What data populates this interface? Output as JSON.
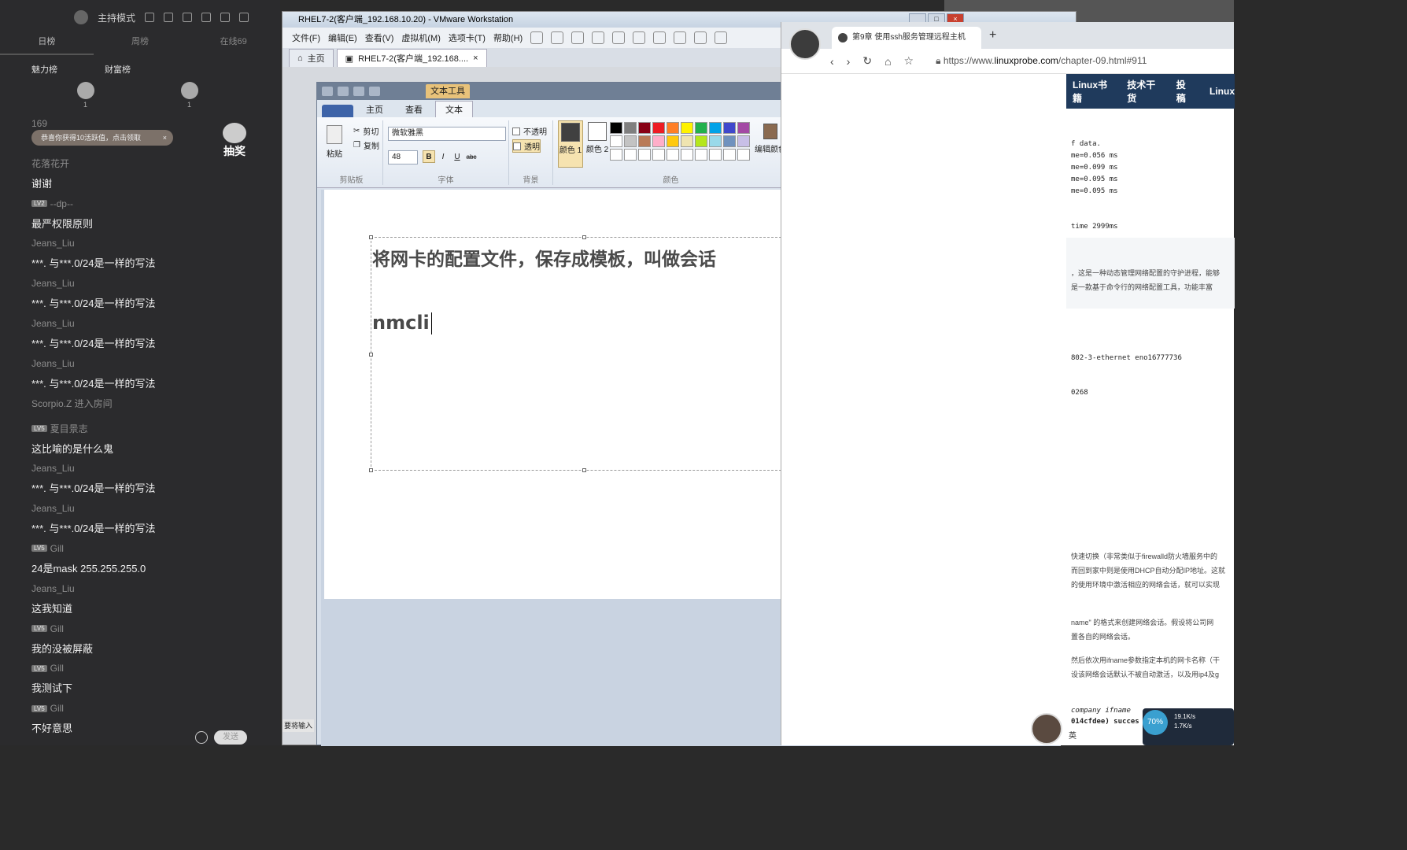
{
  "chat": {
    "mode_label": "主持模式",
    "tabs": [
      "日榜",
      "周榜",
      "在线69"
    ],
    "rank_charm": "魅力榜",
    "rank_wealth": "财富榜",
    "rank_counts": [
      "1",
      "1"
    ],
    "toast": "恭喜你获得10活跃值，点击领取",
    "toast_close": "×",
    "lottery": "抽奖",
    "send": "发送",
    "messages": [
      {
        "user": "169",
        "level": "",
        "text": ""
      },
      {
        "user": "花落花开",
        "level": "",
        "text": "谢谢"
      },
      {
        "user": "--dp--",
        "level": "LV2",
        "text": "最严权限原则"
      },
      {
        "user": "Jeans_Liu",
        "level": "",
        "text": "***. 与***.0/24是一样的写法"
      },
      {
        "user": "Jeans_Liu",
        "level": "",
        "text": "***. 与***.0/24是一样的写法"
      },
      {
        "user": "Jeans_Liu",
        "level": "",
        "text": "***. 与***.0/24是一样的写法"
      },
      {
        "user": "Jeans_Liu",
        "level": "",
        "text": "***. 与***.0/24是一样的写法"
      }
    ],
    "system_msg": "Scorpio.Z 进入房间",
    "messages2": [
      {
        "user": "夏目景志",
        "level": "LV5",
        "text": "这比喻的是什么鬼"
      },
      {
        "user": "Jeans_Liu",
        "level": "",
        "text": "***. 与***.0/24是一样的写法"
      },
      {
        "user": "Jeans_Liu",
        "level": "",
        "text": "***. 与***.0/24是一样的写法"
      },
      {
        "user": "Gill",
        "level": "LV5",
        "text": "24是mask 255.255.255.0"
      },
      {
        "user": "Jeans_Liu",
        "level": "",
        "text": "这我知道"
      },
      {
        "user": "Gill",
        "level": "LV5",
        "text": "我的没被屏蔽"
      },
      {
        "user": "Gill",
        "level": "LV5",
        "text": "我测试下"
      },
      {
        "user": "Gill",
        "level": "LV5",
        "text": "不好意思"
      }
    ]
  },
  "vmware": {
    "title": "RHEL7-2(客户端_192.168.10.20) - VMware Workstation",
    "menu": [
      "文件(F)",
      "编辑(E)",
      "查看(V)",
      "虚拟机(M)",
      "选项卡(T)",
      "帮助(H)"
    ],
    "tabs": [
      "主页",
      "RHEL7-2(客户端_192.168...."
    ],
    "tab_close": "×",
    "status": "要将输入"
  },
  "paint": {
    "context_tab": "文本工具",
    "ribbon_tabs": [
      "主页",
      "查看",
      "文本"
    ],
    "clipboard": {
      "paste": "粘贴",
      "cut": "剪切",
      "copy": "复制",
      "label": "剪贴板"
    },
    "font": {
      "family": "微软雅黑",
      "size": "48",
      "bold": "B",
      "italic": "I",
      "underline": "U",
      "strike": "abc",
      "label": "字体"
    },
    "background": {
      "opaque": "不透明",
      "transparent": "透明",
      "label": "背景"
    },
    "colors": {
      "color1": "颜色 1",
      "color2": "颜色 2",
      "edit": "编辑颜色",
      "label": "颜色"
    },
    "canvas_text": [
      "将网卡的配置文件，保存成模板，叫做会话",
      "nmcli"
    ]
  },
  "browser": {
    "tab_title": "第9章 使用ssh服务管理远程主机",
    "url_prefix": "https://www.",
    "url_domain": "linuxprobe.com",
    "url_path": "/chapter-09.html#911",
    "site_nav": [
      "Linux书籍",
      "技术干货",
      "投稿",
      "Linux"
    ],
    "terminal": [
      "f data.",
      "me=0.056 ms",
      "me=0.099 ms",
      "me=0.095 ms",
      "me=0.095 ms",
      "",
      "",
      "time 2999ms"
    ],
    "para1": [
      "，这是一种动态管理网络配置的守护进程，能够",
      "是一款基于命令行的网络配置工具，功能丰富"
    ],
    "code1": "802-3-ethernet eno16777736",
    "code2": "0268",
    "para2": [
      "快速切换（非常类似于firewalld防火墙服务中的",
      "而回到家中则是使用DHCP自动分配IP地址。这就",
      "的使用环境中激活相应的网络会话，就可以实现"
    ],
    "para3": [
      "name\" 的格式来创建网络会话。假设将公司网",
      "置各自的网络会话。"
    ],
    "para4": [
      "然后依次用ifname参数指定本机的网卡名称（干",
      "设该网络会话默认不被自动激活，以及用ip4及g"
    ],
    "code3": " company ifname ",
    "code4": "014cfdee) succes"
  },
  "widgets": {
    "ime": "英",
    "cpu": "70%",
    "up": "19.1K/s",
    "down": "1.7K/s"
  }
}
